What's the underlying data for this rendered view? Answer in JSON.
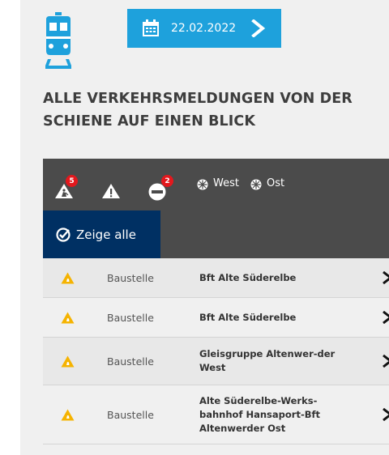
{
  "header": {
    "date": "22.02.2022"
  },
  "headline": {
    "line1": "ALLE VERKEHRSMELDUNGEN VON DER",
    "line2": "SCHIENE AUF EINEN BLICK"
  },
  "filters": {
    "construction_count": "5",
    "closure_count": "2",
    "west_label": "West",
    "east_label": "Ost",
    "show_all_label": "Zeige alle"
  },
  "rows": [
    {
      "type": "Baustelle",
      "location": "Bft Alte Süderelbe"
    },
    {
      "type": "Baustelle",
      "location": "Bft Alte Süderelbe"
    },
    {
      "type": "Baustelle",
      "location": "Gleisgruppe Altenwer-der West"
    },
    {
      "type": "Baustelle",
      "location": "Alte Süderelbe-Werks-bahnhof Hansaport-Bft Altenwerder Ost"
    }
  ],
  "colors": {
    "accent": "#1ea1dc",
    "navy": "#003063",
    "warning": "#f5b301",
    "badge": "#e3181d",
    "filterbar": "#4b4b4b"
  }
}
